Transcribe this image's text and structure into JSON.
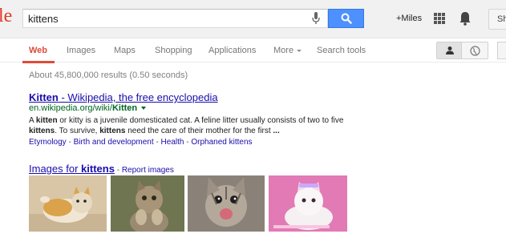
{
  "header": {
    "logo_fragment": "le",
    "search_value": "kittens",
    "plus_user": "+Miles",
    "share_label": "Sh"
  },
  "tabs": [
    {
      "label": "Web",
      "active": true
    },
    {
      "label": "Images"
    },
    {
      "label": "Maps"
    },
    {
      "label": "Shopping"
    },
    {
      "label": "Applications"
    },
    {
      "label": "More"
    },
    {
      "label": "Search tools"
    }
  ],
  "results": {
    "stats": "About 45,800,000 results (0.50 seconds)",
    "first": {
      "title_main": "Kitten",
      "title_rest": " - Wikipedia, the free encyclopedia",
      "url_prefix": "en.wikipedia.org/wiki/",
      "url_bold": "Kitten",
      "snippet": {
        "p1": "A ",
        "b1": "kitten",
        "p2": " or kitty is a juvenile domesticated cat. A feline litter usually consists of two to five ",
        "b2": "kittens",
        "p3": ". To survive, ",
        "b3": "kittens",
        "p4": " need the care of their mother for the first ",
        "b4": "..."
      },
      "sitelinks": [
        "Etymology",
        "Birth and development",
        "Health",
        "Orphaned kittens"
      ],
      "sep": " - "
    },
    "images": {
      "prefix": "Images for ",
      "query": "kittens",
      "dash": " - ",
      "report": "Report images",
      "thumbs": [
        {
          "name": "kitten-on-back",
          "bg": "#d9c6a6"
        },
        {
          "name": "tabby-kitten-paws",
          "bg": "#6f7550"
        },
        {
          "name": "happy-tabby-kitten",
          "bg": "#8a8178"
        },
        {
          "name": "white-kitten-pink",
          "bg": "#e27ab5"
        }
      ]
    }
  },
  "colors": {
    "accent": "#dd4b39",
    "link": "#1a0dab",
    "url": "#006621",
    "search_button": "#4d90fe"
  }
}
